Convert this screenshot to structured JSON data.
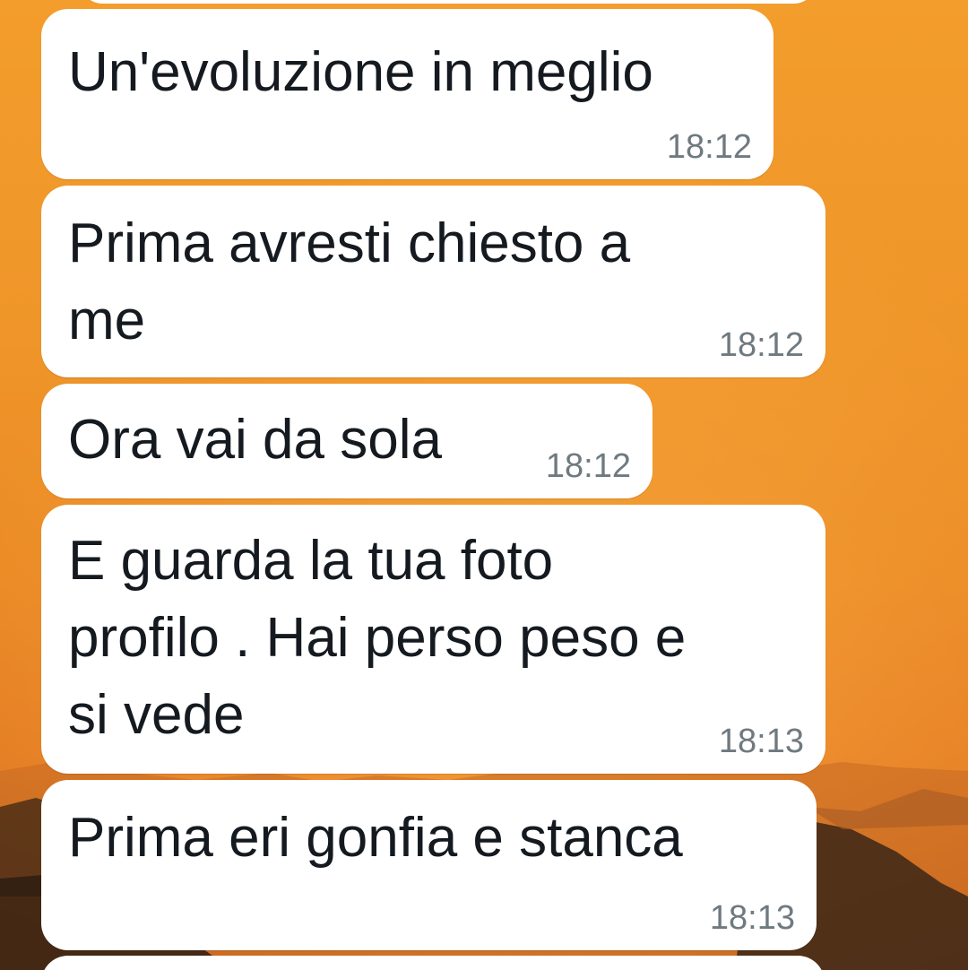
{
  "colors": {
    "wallpaper_top": "#f39d2c",
    "wallpaper_bottom": "#c9601c",
    "bubble_bg": "#ffffff",
    "message_text": "#141a1f",
    "timestamp_text": "#6f7a80"
  },
  "messages": [
    {
      "text": "Un'evoluzione in meglio",
      "time": "18:12"
    },
    {
      "text": "Prima avresti chiesto a\nme",
      "time": "18:12"
    },
    {
      "text": "Ora vai da sola",
      "time": "18:12"
    },
    {
      "text": "E guarda la tua foto\nprofilo . Hai perso peso e\nsi vede",
      "time": "18:13"
    },
    {
      "text": "Prima eri gonfia e stanca",
      "time": "18:13"
    }
  ]
}
